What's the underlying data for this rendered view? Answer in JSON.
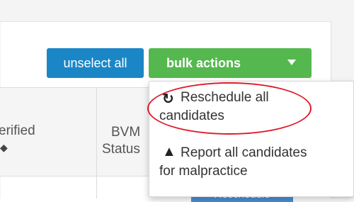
{
  "toolbar": {
    "unselect_label": "unselect all",
    "bulk_label": "bulk actions"
  },
  "table": {
    "headers": [
      {
        "label": "erified"
      },
      {
        "line1": "BVM",
        "line2": "Status"
      }
    ],
    "row_badge": "Reschedule"
  },
  "dropdown": {
    "items": [
      {
        "icon": "refresh-icon",
        "line1": "Reschedule all",
        "line2": "candidates"
      },
      {
        "icon": "warning-icon",
        "line1": "Report all candidates",
        "line2": "for malpractice"
      }
    ]
  },
  "colors": {
    "primary": "#1b86c6",
    "success": "#55b84f",
    "annotation": "#e0192a"
  }
}
